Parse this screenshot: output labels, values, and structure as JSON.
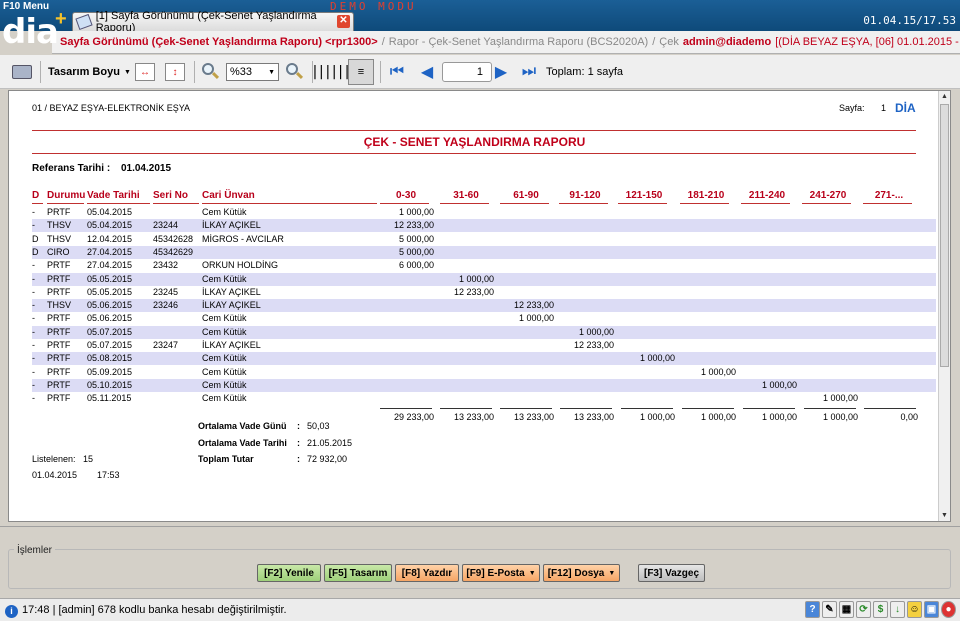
{
  "app": {
    "menu_label": "F10 Menu",
    "logo": "dia",
    "tab_title": "[1] Sayfa Görünümü (Çek-Senet Yaşlandırma Raporu)",
    "demo_banner": "DEMO MODU",
    "clock": "01.04.15/17.53"
  },
  "infobar": {
    "report_name": "Sayfa Görünümü (Çek-Senet Yaşlandırma Raporu) <rpr1300>",
    "path": "Rapor - Çek-Senet Yaşlandırma Raporu (BCS2020A)",
    "module": "Çek",
    "user": "admin@diademo",
    "company": "[(DİA BEYAZ EŞYA, [06] 01.01.2015 - 31.12.2015 *)]"
  },
  "toolbar": {
    "design_label": "Tasarım Boyu",
    "zoom": "%33",
    "page": "1",
    "total_label": "Toplam: 1 sayfa"
  },
  "report": {
    "company_line": "01   /   BEYAZ EŞYA-ELEKTRONİK EŞYA",
    "page_label": "Sayfa:",
    "page_no": "1",
    "brand": "DİA",
    "title": "ÇEK - SENET YAŞLANDIRMA RAPORU",
    "ref_label": "Referans Tarihi :",
    "ref_date": "01.04.2015",
    "columns": [
      "D",
      "Durumu",
      "Vade Tarihi",
      "Seri No",
      "Cari Ünvan",
      "0-30",
      "31-60",
      "61-90",
      "91-120",
      "121-150",
      "181-210",
      "211-240",
      "241-270",
      "271-..."
    ],
    "rows": [
      {
        "d": "-",
        "durum": "PRTF",
        "vade": "05.04.2015",
        "seri": "",
        "cari": "Cem Kütük",
        "col": 0,
        "amount": "1 000,00"
      },
      {
        "d": "-",
        "durum": "THSV",
        "vade": "05.04.2015",
        "seri": "23244",
        "cari": "İLKAY AÇIKEL",
        "col": 0,
        "amount": "12 233,00"
      },
      {
        "d": "D",
        "durum": "THSV",
        "vade": "12.04.2015",
        "seri": "45342628",
        "cari": "MİGROS - AVCILAR",
        "col": 0,
        "amount": "5 000,00"
      },
      {
        "d": "D",
        "durum": "CIRO",
        "vade": "27.04.2015",
        "seri": "45342629",
        "cari": "",
        "col": 0,
        "amount": "5 000,00"
      },
      {
        "d": "-",
        "durum": "PRTF",
        "vade": "27.04.2015",
        "seri": "23432",
        "cari": "ORKUN HOLDİNG",
        "col": 0,
        "amount": "6 000,00"
      },
      {
        "d": "-",
        "durum": "PRTF",
        "vade": "05.05.2015",
        "seri": "",
        "cari": "Cem Kütük",
        "col": 1,
        "amount": "1 000,00"
      },
      {
        "d": "-",
        "durum": "PRTF",
        "vade": "05.05.2015",
        "seri": "23245",
        "cari": "İLKAY AÇIKEL",
        "col": 1,
        "amount": "12 233,00"
      },
      {
        "d": "-",
        "durum": "THSV",
        "vade": "05.06.2015",
        "seri": "23246",
        "cari": "İLKAY AÇIKEL",
        "col": 2,
        "amount": "12 233,00"
      },
      {
        "d": "-",
        "durum": "PRTF",
        "vade": "05.06.2015",
        "seri": "",
        "cari": "Cem Kütük",
        "col": 2,
        "amount": "1 000,00"
      },
      {
        "d": "-",
        "durum": "PRTF",
        "vade": "05.07.2015",
        "seri": "",
        "cari": "Cem Kütük",
        "col": 3,
        "amount": "1 000,00"
      },
      {
        "d": "-",
        "durum": "PRTF",
        "vade": "05.07.2015",
        "seri": "23247",
        "cari": "İLKAY AÇIKEL",
        "col": 3,
        "amount": "12 233,00"
      },
      {
        "d": "-",
        "durum": "PRTF",
        "vade": "05.08.2015",
        "seri": "",
        "cari": "Cem Kütük",
        "col": 4,
        "amount": "1 000,00"
      },
      {
        "d": "-",
        "durum": "PRTF",
        "vade": "05.09.2015",
        "seri": "",
        "cari": "Cem Kütük",
        "col": 5,
        "amount": "1 000,00"
      },
      {
        "d": "-",
        "durum": "PRTF",
        "vade": "05.10.2015",
        "seri": "",
        "cari": "Cem Kütük",
        "col": 6,
        "amount": "1 000,00"
      },
      {
        "d": "-",
        "durum": "PRTF",
        "vade": "05.11.2015",
        "seri": "",
        "cari": "Cem Kütük",
        "col": 7,
        "amount": "1 000,00"
      }
    ],
    "totals": [
      "29 233,00",
      "13 233,00",
      "13 233,00",
      "13 233,00",
      "1 000,00",
      "1 000,00",
      "1 000,00",
      "1 000,00",
      "0,00"
    ],
    "stats": {
      "avg_days_label": "Ortalama Vade Günü",
      "avg_days": "50,03",
      "avg_date_label": "Ortalama Vade Tarihi",
      "avg_date": "21.05.2015",
      "total_label": "Toplam Tutar",
      "total": "72 932,00"
    },
    "listed_label": "Listelenen:",
    "listed_count": "15",
    "print_date": "01.04.2015",
    "print_time": "17:53"
  },
  "actions": {
    "group_label": "İşlemler",
    "refresh": "[F2] Yenile",
    "design": "[F5] Tasarım",
    "print": "[F8] Yazdır",
    "email": "[F9] E-Posta",
    "file": "[F12] Dosya",
    "cancel": "[F3] Vazgeç"
  },
  "status": {
    "message": "17:48 | [admin] 678 kodlu banka hesabı değiştirilmiştir."
  },
  "colors": {
    "accent_red": "#c0001a",
    "header_blue": "#0e4a7a",
    "row_alt": "#dcdcf5"
  }
}
